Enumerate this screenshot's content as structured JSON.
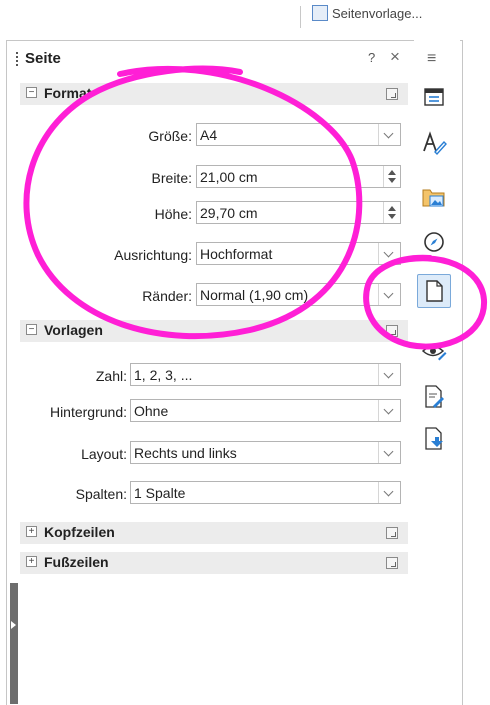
{
  "toolbar": {
    "page_style_button": "Seitenvorlage..."
  },
  "panel": {
    "title": "Seite",
    "help": "?",
    "close": "×",
    "menu": "≡"
  },
  "sections": {
    "format": {
      "title": "Format",
      "size_label": "Größe:",
      "size_value": "A4",
      "width_label": "Breite:",
      "width_value": "21,00 cm",
      "height_label": "Höhe:",
      "height_value": "29,70 cm",
      "orientation_label": "Ausrichtung:",
      "orientation_value": "Hochformat",
      "margins_label": "Ränder:",
      "margins_value": "Normal (1,90 cm)"
    },
    "templates": {
      "title": "Vorlagen",
      "number_label": "Zahl:",
      "number_value": "1, 2, 3, ...",
      "background_label": "Hintergrund:",
      "background_value": "Ohne",
      "layout_label": "Layout:",
      "layout_value": "Rechts und links",
      "columns_label": "Spalten:",
      "columns_value": "1 Spalte"
    },
    "header": {
      "title": "Kopfzeilen"
    },
    "footer": {
      "title": "Fußzeilen"
    }
  },
  "tabs": [
    "properties",
    "styles",
    "gallery",
    "navigator",
    "page",
    "style-inspector",
    "manage-changes",
    "design"
  ],
  "colors": {
    "annotation": "#ff1fd6",
    "selected_tab": "#ddebf9",
    "section_bg": "#ececec"
  }
}
